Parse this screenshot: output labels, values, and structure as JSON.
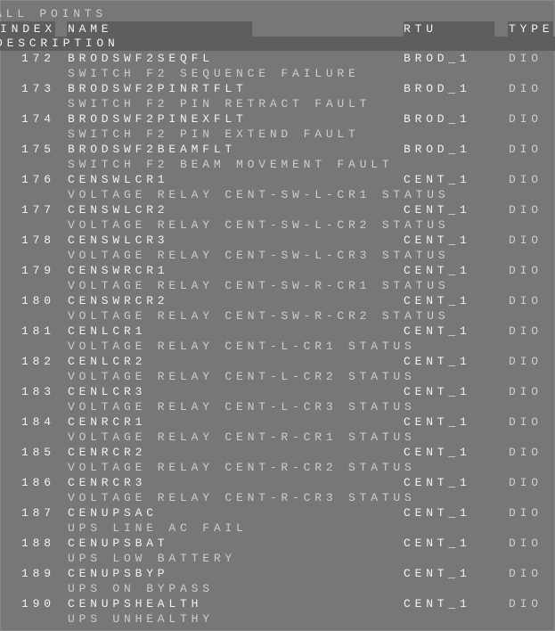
{
  "title": "ALL POINTS",
  "headers": {
    "index": "INDEX",
    "name": "NAME",
    "rtu": "RTU",
    "type": "TYPE",
    "description": "DESCRIPTION"
  },
  "rows": [
    {
      "index": "172",
      "name": "BRODSWF2SEQFL",
      "rtu": "BROD_1",
      "type": "DIO",
      "description": "SWITCH F2 SEQUENCE FAILURE"
    },
    {
      "index": "173",
      "name": "BRODSWF2PINRTFLT",
      "rtu": "BROD_1",
      "type": "DIO",
      "description": "SWITCH F2 PIN RETRACT FAULT"
    },
    {
      "index": "174",
      "name": "BRODSWF2PINEXFLT",
      "rtu": "BROD_1",
      "type": "DIO",
      "description": "SWITCH F2 PIN EXTEND FAULT"
    },
    {
      "index": "175",
      "name": "BRODSWF2BEAMFLT",
      "rtu": "BROD_1",
      "type": "DIO",
      "description": "SWITCH F2 BEAM MOVEMENT FAULT"
    },
    {
      "index": "176",
      "name": "CENSWLCR1",
      "rtu": "CENT_1",
      "type": "DIO",
      "description": "VOLTAGE RELAY CENT-SW-L-CR1 STATUS"
    },
    {
      "index": "177",
      "name": "CENSWLCR2",
      "rtu": "CENT_1",
      "type": "DIO",
      "description": "VOLTAGE RELAY CENT-SW-L-CR2 STATUS"
    },
    {
      "index": "178",
      "name": "CENSWLCR3",
      "rtu": "CENT_1",
      "type": "DIO",
      "description": "VOLTAGE RELAY CENT-SW-L-CR3 STATUS"
    },
    {
      "index": "179",
      "name": "CENSWRCR1",
      "rtu": "CENT_1",
      "type": "DIO",
      "description": "VOLTAGE RELAY CENT-SW-R-CR1 STATUS"
    },
    {
      "index": "180",
      "name": "CENSWRCR2",
      "rtu": "CENT_1",
      "type": "DIO",
      "description": "VOLTAGE RELAY CENT-SW-R-CR2 STATUS"
    },
    {
      "index": "181",
      "name": "CENLCR1",
      "rtu": "CENT_1",
      "type": "DIO",
      "description": "VOLTAGE RELAY CENT-L-CR1 STATUS"
    },
    {
      "index": "182",
      "name": "CENLCR2",
      "rtu": "CENT_1",
      "type": "DIO",
      "description": "VOLTAGE RELAY CENT-L-CR2 STATUS"
    },
    {
      "index": "183",
      "name": "CENLCR3",
      "rtu": "CENT_1",
      "type": "DIO",
      "description": "VOLTAGE RELAY CENT-L-CR3 STATUS"
    },
    {
      "index": "184",
      "name": "CENRCR1",
      "rtu": "CENT_1",
      "type": "DIO",
      "description": "VOLTAGE RELAY CENT-R-CR1 STATUS"
    },
    {
      "index": "185",
      "name": "CENRCR2",
      "rtu": "CENT_1",
      "type": "DIO",
      "description": "VOLTAGE RELAY CENT-R-CR2 STATUS"
    },
    {
      "index": "186",
      "name": "CENRCR3",
      "rtu": "CENT_1",
      "type": "DIO",
      "description": "VOLTAGE RELAY CENT-R-CR3 STATUS"
    },
    {
      "index": "187",
      "name": "CENUPSAC",
      "rtu": "CENT_1",
      "type": "DIO",
      "description": "UPS LINE AC FAIL"
    },
    {
      "index": "188",
      "name": "CENUPSBAT",
      "rtu": "CENT_1",
      "type": "DIO",
      "description": "UPS LOW BATTERY"
    },
    {
      "index": "189",
      "name": "CENUPSBYP",
      "rtu": "CENT_1",
      "type": "DIO",
      "description": "UPS ON BYPASS"
    },
    {
      "index": "190",
      "name": "CENUPSHEALTH",
      "rtu": "CENT_1",
      "type": "DIO",
      "description": "UPS UNHEALTHY"
    }
  ]
}
